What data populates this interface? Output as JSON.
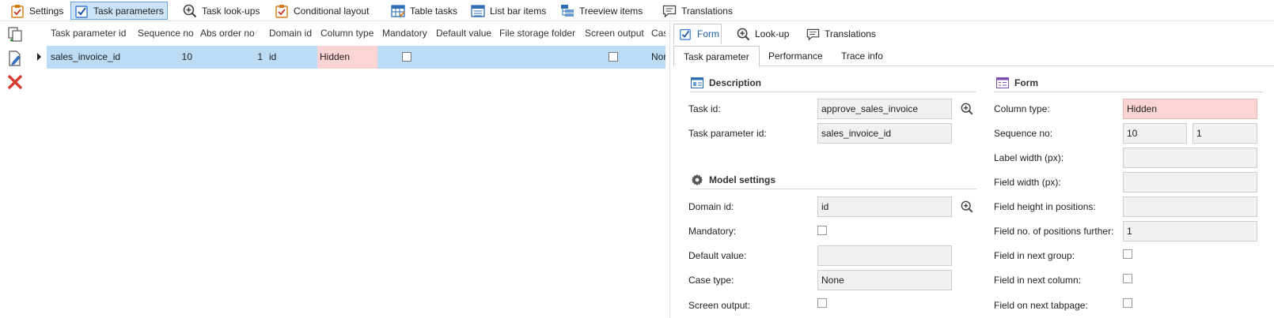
{
  "toolbar": {
    "items": [
      {
        "label": "Settings",
        "icon": "clipboard-check-icon"
      },
      {
        "label": "Task parameters",
        "icon": "checkbox-check-icon",
        "active": true
      },
      {
        "label": "Task look-ups",
        "icon": "zoom-in-icon"
      },
      {
        "label": "Conditional layout",
        "icon": "clipboard-check-icon"
      },
      {
        "label": "Table tasks",
        "icon": "table-check-icon"
      },
      {
        "label": "List bar items",
        "icon": "list-bar-icon"
      },
      {
        "label": "Treeview items",
        "icon": "treeview-icon"
      },
      {
        "label": "Translations",
        "icon": "speech-bubble-icon"
      }
    ]
  },
  "side_actions": [
    {
      "name": "copy-document-icon"
    },
    {
      "name": "edit-document-icon"
    },
    {
      "name": "delete-icon",
      "color": "#d63c2c"
    }
  ],
  "grid": {
    "columns": [
      "Task parameter id",
      "Sequence no",
      "Abs order no",
      "Domain id",
      "Column type",
      "Mandatory",
      "Default value",
      "File storage folder",
      "Screen output",
      "Cas"
    ],
    "rows": [
      {
        "task_parameter_id": "sales_invoice_id",
        "sequence_no": "10",
        "abs_order_no": "1",
        "domain_id": "id",
        "column_type": "Hidden",
        "mandatory": false,
        "default_value": "",
        "file_storage_folder": "",
        "screen_output": false,
        "case_type": "Nor"
      }
    ]
  },
  "detail": {
    "tabs": [
      {
        "label": "Form",
        "icon": "checkbox-check-icon",
        "active": true
      },
      {
        "label": "Look-up",
        "icon": "zoom-in-icon"
      },
      {
        "label": "Translations",
        "icon": "speech-bubble-icon"
      }
    ],
    "subtabs": [
      {
        "label": "Task parameter",
        "active": true
      },
      {
        "label": "Performance"
      },
      {
        "label": "Trace info"
      }
    ],
    "description": {
      "title": "Description",
      "task_id_label": "Task id:",
      "task_id_value": "approve_sales_invoice",
      "task_param_label": "Task parameter id:",
      "task_param_value": "sales_invoice_id"
    },
    "model": {
      "title": "Model settings",
      "domain_label": "Domain id:",
      "domain_value": "id",
      "mandatory_label": "Mandatory:",
      "default_label": "Default value:",
      "default_value": "",
      "case_label": "Case type:",
      "case_value": "None",
      "screen_label": "Screen output:"
    },
    "form": {
      "title": "Form",
      "column_type_label": "Column type:",
      "column_type_value": "Hidden",
      "sequence_label": "Sequence no:",
      "sequence_value": "10",
      "sequence_value2": "1",
      "label_width_label": "Label width (px):",
      "label_width_value": "",
      "field_width_label": "Field width (px):",
      "field_width_value": "",
      "field_height_label": "Field height in positions:",
      "field_height_value": "",
      "field_further_label": "Field no. of positions further:",
      "field_further_value": "1",
      "next_group_label": "Field in next group:",
      "next_column_label": "Field in next column:",
      "next_tabpage_label": "Field on next tabpage:"
    }
  },
  "colors": {
    "selected_row": "#bcdcf5",
    "active_tab": "#cce4f7",
    "hidden_cell": "#fbd4d4",
    "accent": "#1c5fa8"
  }
}
